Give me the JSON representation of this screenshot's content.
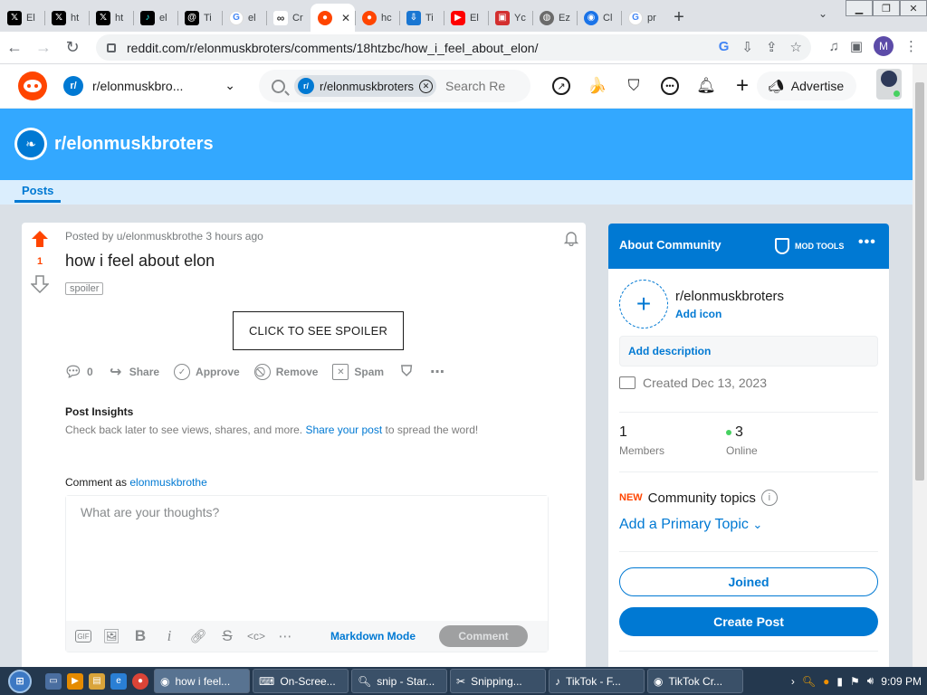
{
  "browser": {
    "tabs": [
      {
        "favicon": "x-icon",
        "label": "El"
      },
      {
        "favicon": "x-icon",
        "label": "ht"
      },
      {
        "favicon": "x-icon",
        "label": "ht"
      },
      {
        "favicon": "tiktok-icon",
        "label": "el"
      },
      {
        "favicon": "threads-icon",
        "label": "Ti"
      },
      {
        "favicon": "google-icon",
        "label": "el"
      },
      {
        "favicon": "infinity-icon",
        "label": "Cr"
      },
      {
        "favicon": "reddit-icon",
        "label": "",
        "active": true
      },
      {
        "favicon": "reddit-icon",
        "label": "hc"
      },
      {
        "favicon": "download-icon",
        "label": "Ti"
      },
      {
        "favicon": "youtube-icon",
        "label": "El"
      },
      {
        "favicon": "red-icon",
        "label": "Yc"
      },
      {
        "favicon": "globe-icon",
        "label": "Ez"
      },
      {
        "favicon": "chrome-icon",
        "label": "Cl"
      },
      {
        "favicon": "google-icon",
        "label": "pr"
      }
    ],
    "new_tab": "+",
    "url": "reddit.com/r/elonmuskbroters/comments/18htzbc/how_i_feel_about_elon/",
    "profile_initial": "M"
  },
  "header": {
    "community_short": "r/elonmuskbro...",
    "search_chip": "r/elonmuskbroters",
    "search_placeholder": "Search Re",
    "advertise": "Advertise"
  },
  "banner": {
    "title": "r/elonmuskbroters",
    "tab": "Posts"
  },
  "post": {
    "meta": "Posted by u/elonmuskbrothe 3 hours ago",
    "score": "1",
    "title": "how i feel about elon",
    "flair": "spoiler",
    "spoiler_button": "CLICK TO SEE SPOILER",
    "actions": {
      "comments": "0",
      "share": "Share",
      "approve": "Approve",
      "remove": "Remove",
      "spam": "Spam"
    },
    "insights_title": "Post Insights",
    "insights_pre": "Check back later to see views, shares, and more. ",
    "insights_link": "Share your post",
    "insights_post": " to spread the word!",
    "comment_as_label": "Comment as ",
    "comment_as_user": "elonmuskbrothe",
    "comment_placeholder": "What are your thoughts?",
    "markdown_mode": "Markdown Mode",
    "comment_button": "Comment"
  },
  "sidebar": {
    "heading": "About Community",
    "mod_tools": "MOD TOOLS",
    "community_name": "r/elonmuskbroters",
    "add_icon": "Add icon",
    "add_description": "Add description",
    "created": "Created Dec 13, 2023",
    "members_count": "1",
    "members_label": "Members",
    "online_count": "3",
    "online_label": "Online",
    "new_tag": "NEW",
    "topics": "Community topics",
    "add_topic": "Add a Primary Topic",
    "joined": "Joined",
    "create_post": "Create Post"
  },
  "taskbar": {
    "tasks": [
      {
        "label": "how i feel...",
        "icon": "chrome-icon",
        "active": true
      },
      {
        "label": "On-Scree...",
        "icon": "keyboard-icon"
      },
      {
        "label": "snip - Star...",
        "icon": "search-icon"
      },
      {
        "label": "Snipping...",
        "icon": "scissors-icon"
      },
      {
        "label": "TikTok - F...",
        "icon": "tiktok-icon"
      },
      {
        "label": "TikTok Cr...",
        "icon": "chrome-icon"
      }
    ],
    "time": "9:09 PM"
  },
  "colors": {
    "reddit_orange": "#ff4500",
    "reddit_blue": "#0079d3",
    "banner": "#33a8ff"
  }
}
